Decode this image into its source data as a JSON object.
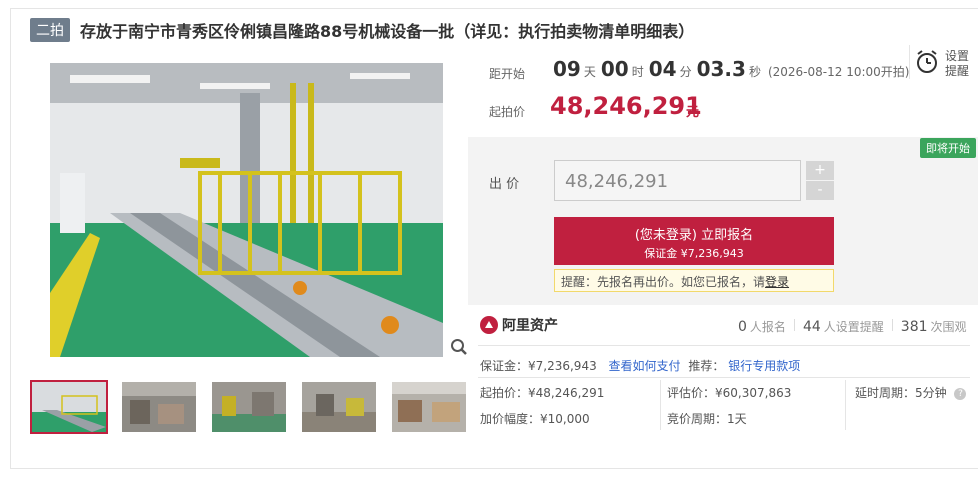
{
  "header": {
    "badge": "二拍",
    "title": "存放于南宁市青秀区伶俐镇昌隆路88号机械设备一批（详见：执行拍卖物清单明细表）"
  },
  "countdown": {
    "label": "距开始",
    "days": "09",
    "days_unit": "天",
    "hours": "00",
    "hours_unit": "时",
    "minutes": "04",
    "minutes_unit": "分",
    "seconds": "03.3",
    "seconds_unit": "秒",
    "start_time": "(2026-08-12 10:00开拍)"
  },
  "reminder": {
    "label_1": "设置",
    "label_2": "提醒",
    "icon": "alarm-clock-icon"
  },
  "starting_price": {
    "label": "起拍价",
    "value": "48,246,291",
    "unit": "元"
  },
  "bid": {
    "status_tag": "即将开始",
    "label": "出  价",
    "input_value": "48,246,291",
    "plus": "+",
    "minus": "-"
  },
  "signup": {
    "line1": "(您未登录) 立即报名",
    "line2": "保证金 ¥7,236,943"
  },
  "notice": {
    "text": "提醒：先报名再出价。如您已报名，请",
    "login": "登录"
  },
  "brand": {
    "name": "阿里资产"
  },
  "stats": {
    "signups": "0",
    "signups_label": "人报名",
    "reminders": "44",
    "reminders_label": "人设置提醒",
    "views": "381",
    "views_label": "次围观"
  },
  "info": {
    "deposit": "保证金：¥7,236,943",
    "how_to_pay": "查看如何支付",
    "recommend": "推荐：",
    "bank_fund": "银行专用款项",
    "start_price": "起拍价：¥48,246,291",
    "appraisal": "评估价：¥60,307,863",
    "delay": "延时周期：5分钟",
    "increment": "加价幅度：¥10,000",
    "cycle": "竞价周期：1天"
  },
  "colors": {
    "accent": "#c0203f",
    "link": "#3366cc",
    "tag_green": "#3ba55c"
  }
}
